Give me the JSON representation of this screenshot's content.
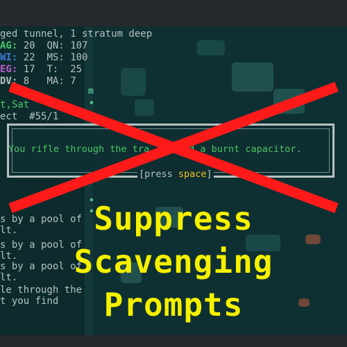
{
  "header": {
    "location": "ged tunnel, 1 stratum deep"
  },
  "stats": [
    {
      "label": "AG:",
      "value": "20",
      "label2": "QN:",
      "value2": "107",
      "color": "#4cc766"
    },
    {
      "label": "WI:",
      "value": "22",
      "label2": "MS:",
      "value2": "100",
      "color": "#3e7bd6"
    },
    {
      "label": "EG:",
      "value": "17",
      "label2": "T:",
      "value2": "25",
      "color": "#c05ad0"
    },
    {
      "label": "DV:",
      "value": "8",
      "label2": "MA:",
      "value2": "7",
      "color": "#b4c2c2"
    }
  ],
  "partial_lines": {
    "line1": "t,Sat",
    "line2": "ect  #55/1"
  },
  "dialog": {
    "message": "You rifle through the tra    find a burnt capacitor.",
    "press_prefix": "[press ",
    "press_key": "space",
    "press_suffix": "]"
  },
  "message_log": [
    "s by a pool of",
    "lt.",
    "s by a pool of",
    "lt.",
    "s by a pool of",
    "lt.",
    "le through the",
    "t you find"
  ],
  "overlay": {
    "line1": "Suppress",
    "line2": "Scavenging",
    "line3": "Prompts",
    "text_color": "#f5f000",
    "cross_color": "#ff1a1a"
  },
  "map_glyphs": [
    "m",
    "•",
    "•",
    "•",
    "•",
    "•"
  ]
}
